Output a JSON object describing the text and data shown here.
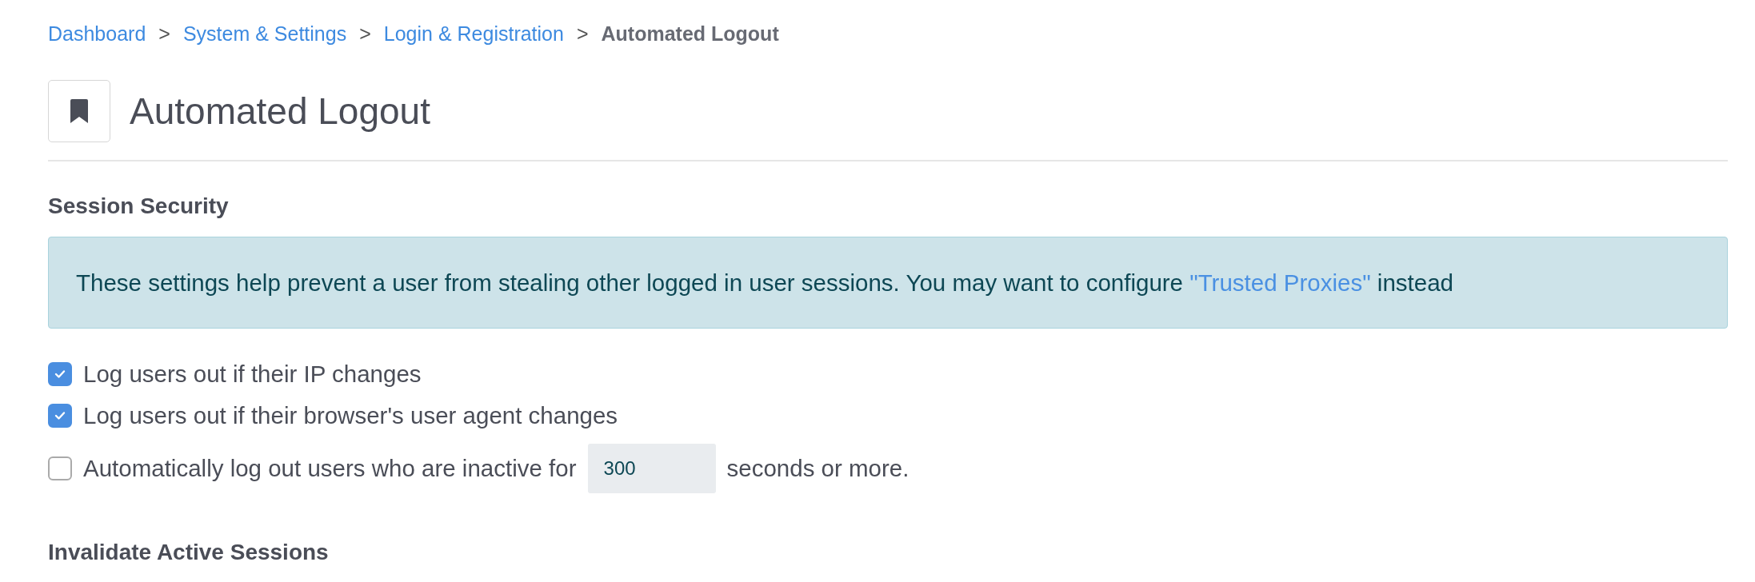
{
  "breadcrumb": {
    "separator": ">",
    "items": [
      {
        "label": "Dashboard",
        "current": false
      },
      {
        "label": "System & Settings",
        "current": false
      },
      {
        "label": "Login & Registration",
        "current": false
      },
      {
        "label": "Automated Logout",
        "current": true
      }
    ]
  },
  "page_title": "Automated Logout",
  "sections": [
    {
      "heading": "Session Security",
      "alert": {
        "text_before": "These settings help prevent a user from stealing other logged in user sessions. You may want to configure ",
        "link": "\"Trusted Proxies\"",
        "text_after": " instead"
      },
      "options": [
        {
          "kind": "plain",
          "checked": true,
          "label": "Log users out if their IP changes"
        },
        {
          "kind": "plain",
          "checked": true,
          "label": "Log users out if their browser's user agent changes"
        },
        {
          "kind": "timeout",
          "checked": false,
          "label": "Automatically log out users who are inactive for",
          "value": "300",
          "label_after": "seconds or more."
        }
      ]
    },
    {
      "heading": "Invalidate Active Sessions"
    }
  ]
}
